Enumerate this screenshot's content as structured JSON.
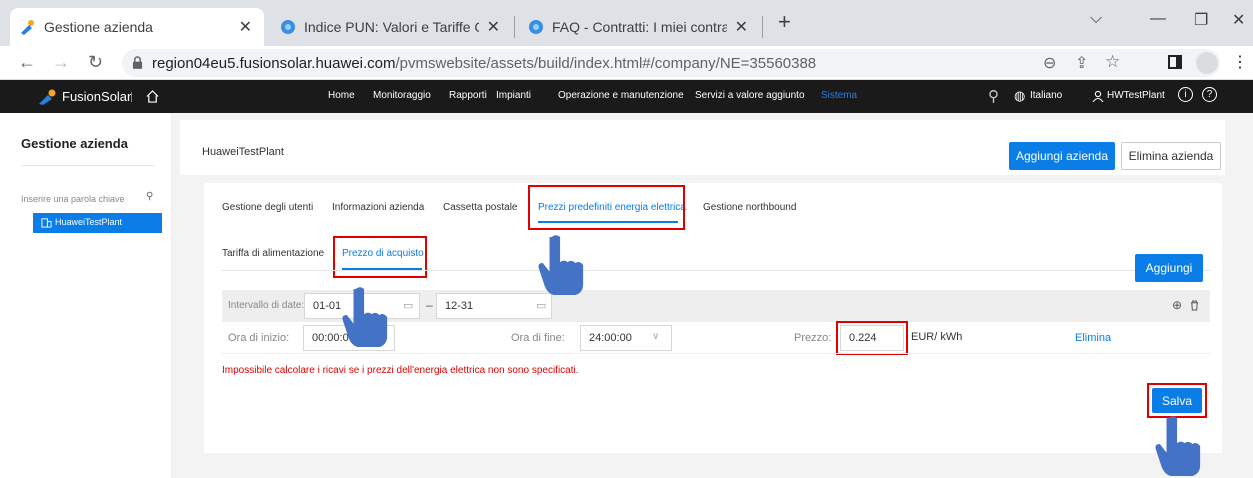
{
  "browser": {
    "tabs": [
      {
        "title": "Gestione azienda",
        "active": true
      },
      {
        "title": "Indice PUN: Valori e Tariffe Gas Se",
        "active": false
      },
      {
        "title": "FAQ - Contratti: I miei contratti | /",
        "active": false
      }
    ],
    "url_main": "region04eu5.fusionsolar.huawei.com",
    "url_path": "/pvmswebsite/assets/build/index.html#/company/NE=35560388"
  },
  "header": {
    "brand": "FusionSolar",
    "nav": [
      "Home",
      "Monitoraggio",
      "Rapporti",
      "Impianti",
      "Operazione e manutenzione",
      "Servizi a valore aggiunto",
      "Sistema"
    ],
    "language": "Italiano",
    "user": "HWTestPlant"
  },
  "sidebar": {
    "title": "Gestione azienda",
    "search_placeholder": "Inserire una parola chiave",
    "tree_item": "HuaweiTestPlant"
  },
  "main": {
    "company_name": "HuaweiTestPlant",
    "add_company": "Aggiungi azienda",
    "delete_company": "Elimina azienda",
    "tabs": [
      "Gestione degli utenti",
      "Informazioni azienda",
      "Cassetta postale",
      "Prezzi predefiniti energia elettrica",
      "Gestione northbound"
    ],
    "subtabs": [
      "Tariffa di alimentazione",
      "Prezzo di acquisto"
    ],
    "add_button": "Aggiungi",
    "date_label": "Intervallo di date:",
    "date_from": "01-01",
    "date_sep": "–",
    "date_to": "12-31",
    "start_label": "Ora di inizio:",
    "start_value": "00:00:00",
    "end_label": "Ora di fine:",
    "end_value": "24:00:00",
    "price_label": "Prezzo:",
    "price_value": "0.224",
    "price_unit": "EUR/ kWh",
    "delete_row": "Elimina",
    "error": "Impossibile calcolare i ricavi se i prezzi dell'energia elettrica non sono specificati.",
    "save": "Salva"
  },
  "colors": {
    "accent": "#0a7de6",
    "highlight": "#e00000",
    "header_bg": "#1a1a1a",
    "hand": "#4472c4"
  }
}
